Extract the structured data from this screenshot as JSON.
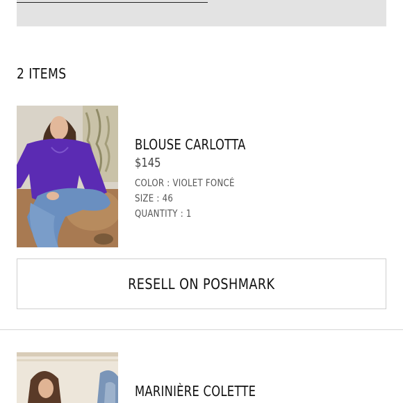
{
  "cart": {
    "items_count_label": "2 ITEMS"
  },
  "products": [
    {
      "name": "BLOUSE CARLOTTA",
      "price": "$145",
      "color_line": "COLOR : VIOLET FONCÉ",
      "size_line": "SIZE : 46",
      "quantity_line": "QUANTITY : 1",
      "image_icon": "product-photo-purple-blouse",
      "resell_label": "RESELL ON POSHMARK"
    },
    {
      "name": "MARINIÈRE COLETTE",
      "image_icon": "product-photo-striped-top"
    }
  ],
  "colors": {
    "top_panel": "#e3e3e3",
    "text": "#111111",
    "muted_text": "#555555",
    "border": "#cfcfcf"
  }
}
